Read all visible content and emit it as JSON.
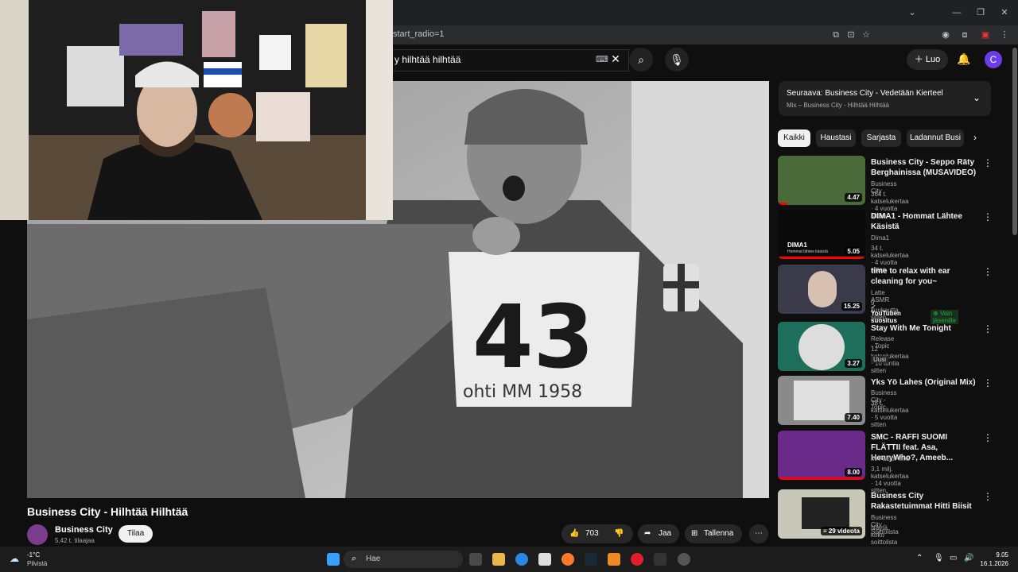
{
  "browser": {
    "url_fragment": "start_radio=1"
  },
  "youtube": {
    "search_value": "y hilhtää hilhtää",
    "create_label": "Luo",
    "avatar_letter": "C"
  },
  "video": {
    "bib_number": "43",
    "bib_text": "ohti MM 1958",
    "title": "Business City - Hilhtää Hilhtää",
    "channel_name": "Business City",
    "subscribers": "5,42 t. tilaajaa",
    "subscribe_label": "Tilaa",
    "likes": "703",
    "share_label": "Jaa",
    "save_label": "Tallenna"
  },
  "up_next": {
    "title": "Seuraava: Business City - Vedetään Kierteel",
    "subtitle": "Mix – Business City - Hilhtää Hilhtää"
  },
  "chips": [
    "Kaikki",
    "Haustasi",
    "Sarjasta",
    "Ladannut Busi"
  ],
  "recommendations": [
    {
      "title": "Business City - Seppo Räty Berghainissa (MUSAVIDEO)",
      "channel": "Business City",
      "meta": "364 t. katselukertaa · 4 vuotta sitten",
      "duration": "4.47",
      "thumb_color": "#4a6a3a"
    },
    {
      "title": "DIMA1 - Hommat Lähtee Käsistä",
      "channel": "Dima1",
      "meta": "34 t. katselukertaa · 4 vuotta sitten",
      "duration": "5.05",
      "thumb_color": "#0a0a0a",
      "thumb_text": "DIMA1",
      "thumb_sub": "Hommat lähtee käsistä"
    },
    {
      "title": "time to relax with ear cleaning for you~",
      "channel": "Latte ASMR",
      "meta": "9 kuukautta sitten",
      "duration": "15.25",
      "thumb_color": "#3a3a4a",
      "badge1": "YouTuben suositus",
      "badge2": "Vain jäsenille"
    },
    {
      "title": "Stay With Me Tonight",
      "channel": "Release - Topic",
      "meta": "12 katselukertaa · 16 tuntia sitten",
      "duration": "3.27",
      "thumb_color": "#1d6e5a",
      "badge1": "Uusi"
    },
    {
      "title": "Yks Yö Lahes (Original Mix)",
      "channel": "Business City - Topic",
      "meta": "38 t. katselukertaa · 5 vuotta sitten",
      "duration": "7.40",
      "thumb_color": "#8a8a8a"
    },
    {
      "title": "SMC - RAFFI SUOMI FLÄTTII feat. Asa, HenryWho?, Ameeb...",
      "channel": "MrPabloFilms",
      "meta": "3,1 milj. katselukertaa · 14 vuotta sitten",
      "duration": "8.00",
      "thumb_color": "#6a2a8a"
    },
    {
      "title": "Business City Rakastetuimmat Hitti Biisit",
      "channel": "Business City · Soittolista",
      "meta": "Näytä koko soittolista",
      "duration": "29 videota",
      "thumb_color": "#c8c8b8"
    }
  ],
  "taskbar": {
    "weather_temp": "-1°C",
    "weather_desc": "Pilvistä",
    "search_placeholder": "Hae",
    "time": "9.05",
    "date": "16.1.2026"
  },
  "colors": {
    "background": "#0f0f0f",
    "accent_avatar": "#6a3de8",
    "verified_green": "#2ba640",
    "progress_red": "#ff0000"
  }
}
